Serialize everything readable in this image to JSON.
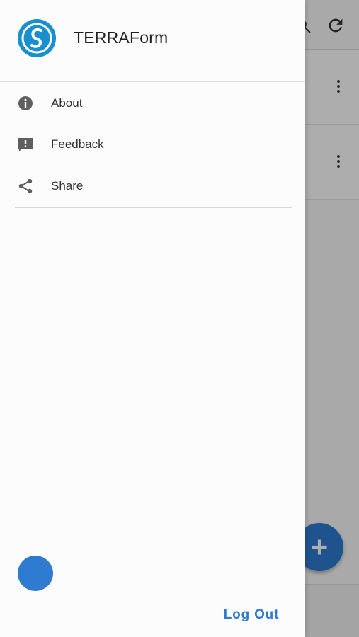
{
  "app": {
    "title": "TERRAForm"
  },
  "drawer": {
    "items": [
      {
        "label": "About",
        "icon": "info-icon"
      },
      {
        "label": "Feedback",
        "icon": "feedback-icon"
      },
      {
        "label": "Share",
        "icon": "share-icon"
      }
    ],
    "logout_label": "Log Out"
  },
  "background": {
    "toolbar_icons": [
      "search-icon",
      "refresh-icon"
    ],
    "card_menu_icons": [
      "more-vert-icon",
      "more-vert-icon"
    ],
    "fab_icon": "add-icon"
  },
  "colors": {
    "accent": "#2f7bd1",
    "scrim": "rgba(0,0,0,0.32)",
    "drawer_bg": "#fcfcfc"
  }
}
